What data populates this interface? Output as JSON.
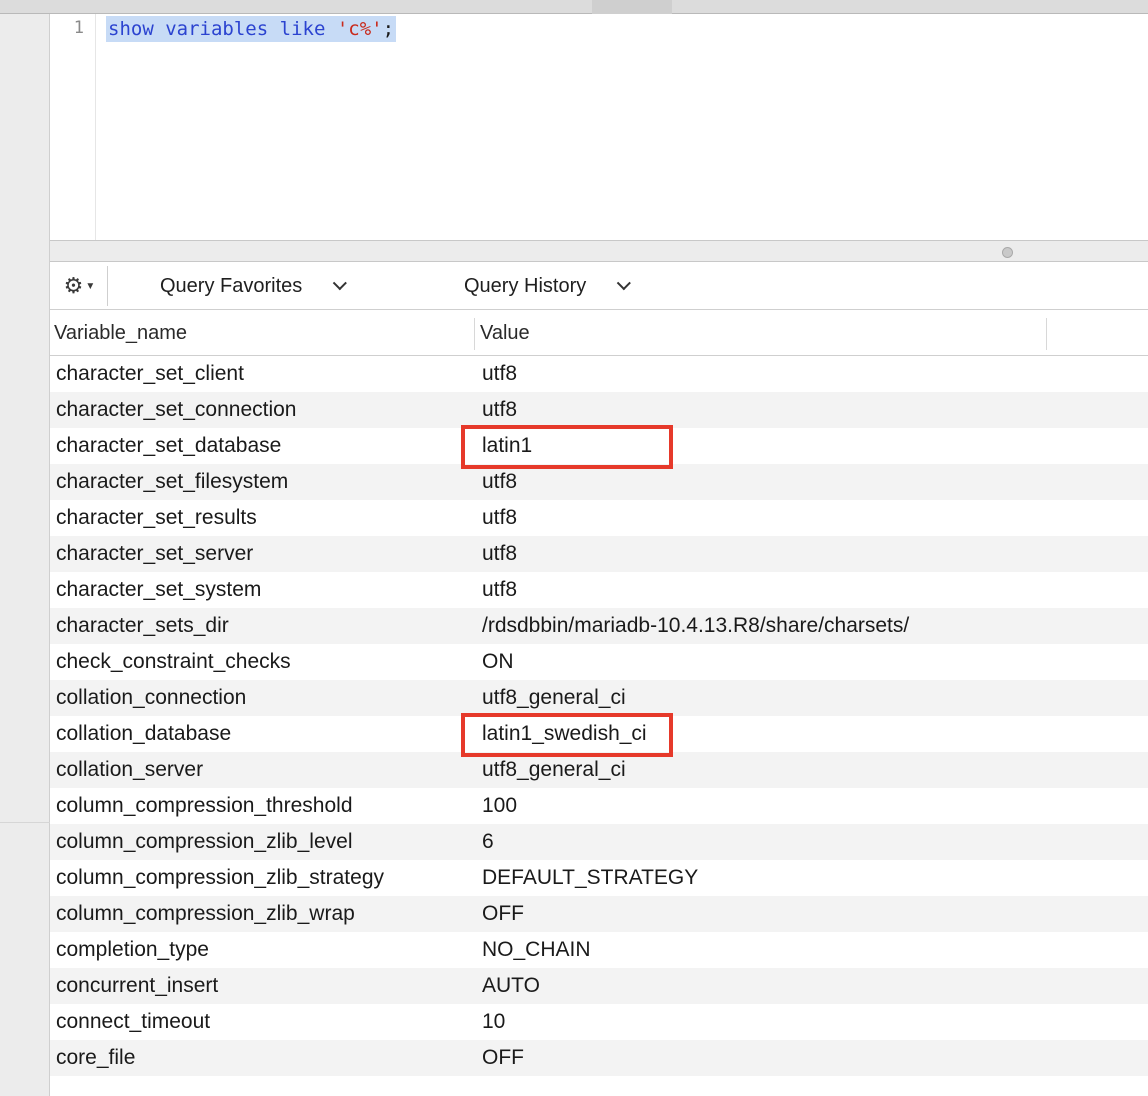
{
  "editor": {
    "line_number": "1",
    "code": {
      "kw1": "show",
      "kw2": "variables",
      "kw3": "like",
      "string": "'c%'",
      "terminator": ";"
    }
  },
  "toolbar": {
    "favorites_label": "Query Favorites",
    "history_label": "Query History"
  },
  "table": {
    "columns": [
      "Variable_name",
      "Value"
    ],
    "rows": [
      {
        "name": "character_set_client",
        "value": "utf8"
      },
      {
        "name": "character_set_connection",
        "value": "utf8"
      },
      {
        "name": "character_set_database",
        "value": "latin1"
      },
      {
        "name": "character_set_filesystem",
        "value": "utf8"
      },
      {
        "name": "character_set_results",
        "value": "utf8"
      },
      {
        "name": "character_set_server",
        "value": "utf8"
      },
      {
        "name": "character_set_system",
        "value": "utf8"
      },
      {
        "name": "character_sets_dir",
        "value": "/rdsdbbin/mariadb-10.4.13.R8/share/charsets/"
      },
      {
        "name": "check_constraint_checks",
        "value": "ON"
      },
      {
        "name": "collation_connection",
        "value": "utf8_general_ci"
      },
      {
        "name": "collation_database",
        "value": "latin1_swedish_ci"
      },
      {
        "name": "collation_server",
        "value": "utf8_general_ci"
      },
      {
        "name": "column_compression_threshold",
        "value": "100"
      },
      {
        "name": "column_compression_zlib_level",
        "value": "6"
      },
      {
        "name": "column_compression_zlib_strategy",
        "value": "DEFAULT_STRATEGY"
      },
      {
        "name": "column_compression_zlib_wrap",
        "value": "OFF"
      },
      {
        "name": "completion_type",
        "value": "NO_CHAIN"
      },
      {
        "name": "concurrent_insert",
        "value": "AUTO"
      },
      {
        "name": "connect_timeout",
        "value": "10"
      },
      {
        "name": "core_file",
        "value": "OFF"
      }
    ]
  },
  "highlight_color": "#e6392a",
  "selection_color": "#c7dbf6"
}
